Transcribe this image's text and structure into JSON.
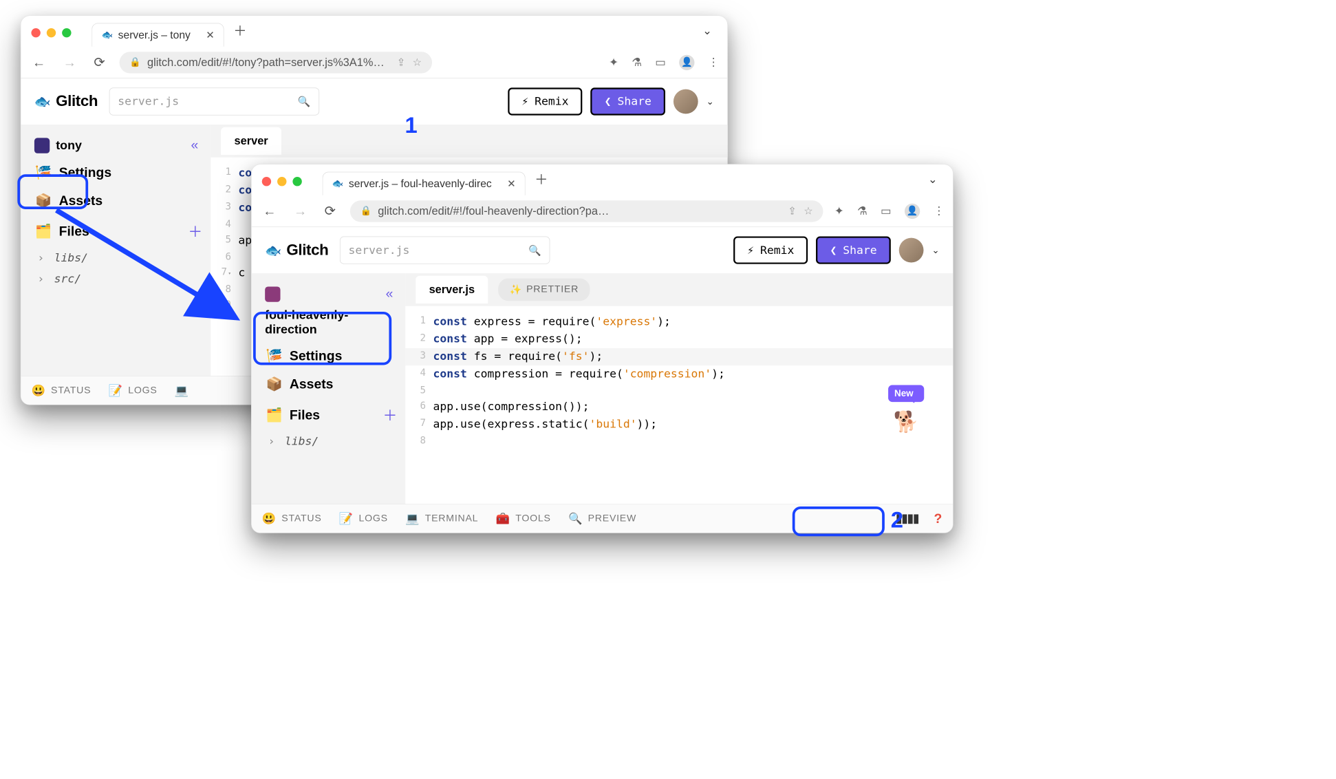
{
  "annotations": {
    "one": "1",
    "two": "2"
  },
  "win_back": {
    "tab_title": "server.js – tony",
    "url": "glitch.com/edit/#!/tony?path=server.js%3A1%…",
    "app": {
      "brand": "Glitch",
      "search_placeholder": "server.js",
      "remix": "Remix",
      "share": "Share",
      "project": "tony",
      "sidebar": {
        "settings": "Settings",
        "assets": "Assets",
        "files": "Files",
        "folders": [
          "libs/",
          "src/"
        ]
      },
      "editor": {
        "filename": "server",
        "lines": [
          {
            "n": "1",
            "src": "const"
          },
          {
            "n": "2",
            "src": "const"
          },
          {
            "n": "3",
            "src": "const"
          },
          {
            "n": "4",
            "src": ""
          },
          {
            "n": "5",
            "src": "ap"
          },
          {
            "n": "6",
            "src": ""
          },
          {
            "n": "7",
            "src": "c"
          },
          {
            "n": "8",
            "src": ""
          },
          {
            "n": "9",
            "src": ""
          }
        ]
      },
      "footer": {
        "status": "STATUS",
        "logs": "LOGS"
      }
    }
  },
  "win_front": {
    "tab_title": "server.js – foul-heavenly-direc",
    "url": "glitch.com/edit/#!/foul-heavenly-direction?pa…",
    "app": {
      "brand": "Glitch",
      "search_placeholder": "server.js",
      "remix": "Remix",
      "share": "Share",
      "project": "foul-heavenly-direction",
      "sidebar": {
        "settings": "Settings",
        "assets": "Assets",
        "files": "Files",
        "folders": [
          "libs/"
        ]
      },
      "editor": {
        "filename": "server.js",
        "prettier": "PRETTIER",
        "lines": [
          {
            "n": "1",
            "t": [
              {
                "c": "kw",
                "s": "const"
              },
              {
                "c": "",
                "s": " express = require("
              },
              {
                "c": "str",
                "s": "'express'"
              },
              {
                "c": "",
                "s": ");"
              }
            ]
          },
          {
            "n": "2",
            "t": [
              {
                "c": "kw",
                "s": "const"
              },
              {
                "c": "",
                "s": " app = express();"
              }
            ]
          },
          {
            "n": "3",
            "hl": true,
            "t": [
              {
                "c": "kw",
                "s": "const"
              },
              {
                "c": "",
                "s": " fs = require("
              },
              {
                "c": "str",
                "s": "'fs'"
              },
              {
                "c": "",
                "s": ");"
              }
            ]
          },
          {
            "n": "4",
            "t": [
              {
                "c": "kw",
                "s": "const"
              },
              {
                "c": "",
                "s": " compression = require("
              },
              {
                "c": "str",
                "s": "'compression'"
              },
              {
                "c": "",
                "s": ");"
              }
            ]
          },
          {
            "n": "5",
            "t": [
              {
                "c": "",
                "s": ""
              }
            ]
          },
          {
            "n": "6",
            "t": [
              {
                "c": "",
                "s": "app.use(compression());"
              }
            ]
          },
          {
            "n": "7",
            "t": [
              {
                "c": "",
                "s": "app.use(express.static("
              },
              {
                "c": "str",
                "s": "'build'"
              },
              {
                "c": "",
                "s": "));"
              }
            ]
          },
          {
            "n": "8",
            "t": [
              {
                "c": "",
                "s": ""
              }
            ]
          }
        ]
      },
      "footer": {
        "status": "STATUS",
        "logs": "LOGS",
        "terminal": "TERMINAL",
        "tools": "TOOLS",
        "preview": "PREVIEW"
      },
      "badge": "New"
    }
  }
}
